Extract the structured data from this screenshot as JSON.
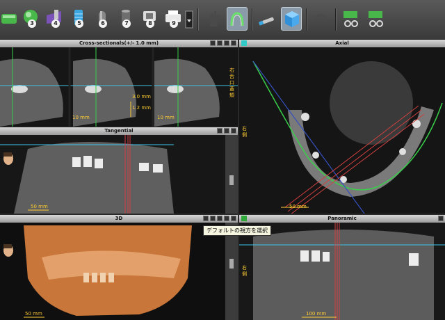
{
  "toolbar": {
    "tools": [
      {
        "icon": "ruler-tool-icon",
        "num": ""
      },
      {
        "icon": "sphere-tool-icon",
        "num": "3"
      },
      {
        "icon": "implant-plan-icon",
        "num": "4"
      },
      {
        "icon": "implant-icon",
        "num": "5"
      },
      {
        "icon": "tube-icon",
        "num": "6"
      },
      {
        "icon": "cylinder-icon",
        "num": "7"
      },
      {
        "icon": "sleeve-icon",
        "num": "8"
      },
      {
        "icon": "printer-icon",
        "num": "9"
      }
    ]
  },
  "panels": {
    "cross": {
      "title": "Cross-sectionals(+/- 1.0 mm)",
      "scale": "10 mm",
      "m1": "3.0 mm",
      "m2": "1.2 mm",
      "side": "右 舌 口蓋 頬"
    },
    "axial": {
      "title": "Axial",
      "scale": "50 mm",
      "side": "右側"
    },
    "tangential": {
      "title": "Tangential",
      "scale": "50 mm"
    },
    "three_d": {
      "title": "3D",
      "scale": "50 mm"
    },
    "panoramic": {
      "title": "Panoramic",
      "scale": "100 mm",
      "side": "右側"
    }
  },
  "tooltip": "デフォルトの視方を選択",
  "colors": {
    "accent": "#33c9c9",
    "guide": "#3ec3e6",
    "green": "#39d04a",
    "red": "#d04040",
    "bone": "#c8763a"
  }
}
